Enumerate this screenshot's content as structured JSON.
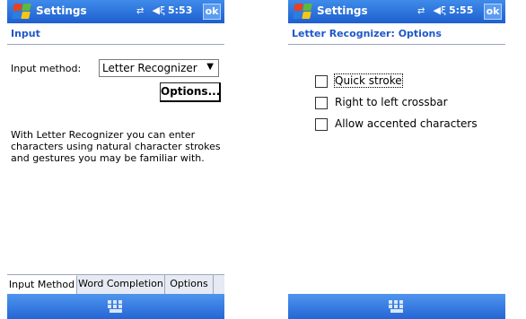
{
  "colors": {
    "titlebar": "#2f76df",
    "header_text": "#1e57c8",
    "logo_red": "#e8411f",
    "logo_green": "#5fb83a",
    "logo_blue": "#2a7de1",
    "logo_yellow": "#f4c51a"
  },
  "left": {
    "titlebar": {
      "title": "Settings",
      "signal_icon": "signal-icon",
      "speaker_icon": "speaker-icon",
      "time": "5:53",
      "ok_label": "ok"
    },
    "header": "Input",
    "input_method_label": "Input method:",
    "input_method_value": "Letter Recognizer",
    "options_button": "Options...",
    "description": "With Letter Recognizer you can enter characters using natural character strokes and gestures you may be familiar with.",
    "tabs": [
      {
        "label": "Input Method",
        "selected": true
      },
      {
        "label": "Word Completion",
        "selected": false
      },
      {
        "label": "Options",
        "selected": false
      }
    ],
    "menubar_icon": "keyboard-icon"
  },
  "right": {
    "titlebar": {
      "title": "Settings",
      "time": "5:55",
      "ok_label": "ok"
    },
    "header": "Letter Recognizer: Options",
    "checkboxes": [
      {
        "label": "Quick stroke",
        "checked": false,
        "focused": true
      },
      {
        "label": "Right to left crossbar",
        "checked": false,
        "focused": false
      },
      {
        "label": "Allow accented characters",
        "checked": false,
        "focused": false
      }
    ],
    "menubar_icon": "keyboard-icon"
  }
}
